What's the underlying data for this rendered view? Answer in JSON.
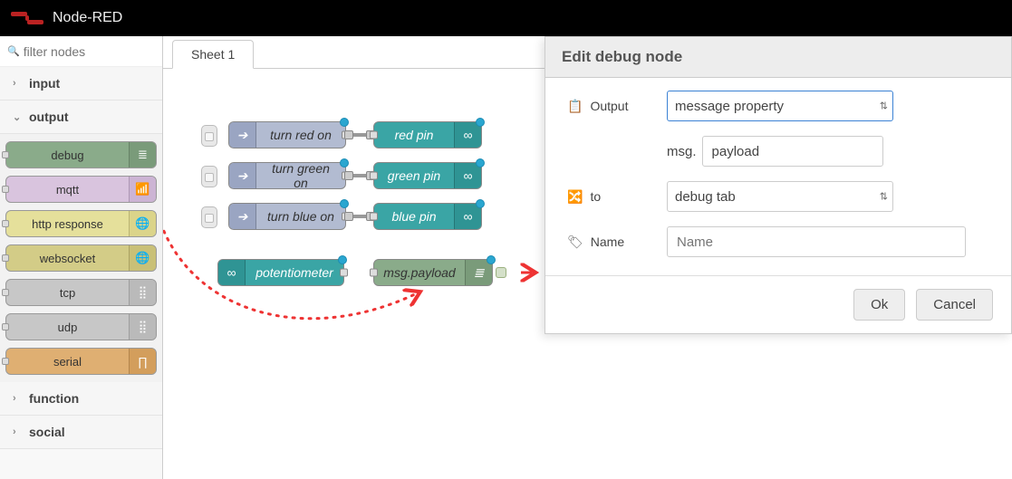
{
  "app": {
    "title": "Node-RED"
  },
  "palette": {
    "filter_placeholder": "filter nodes",
    "categories": {
      "input": {
        "label": "input",
        "open": false
      },
      "output": {
        "label": "output",
        "open": true
      },
      "function": {
        "label": "function",
        "open": false
      },
      "social": {
        "label": "social",
        "open": false
      }
    },
    "output_nodes": {
      "debug": {
        "label": "debug",
        "icon": "list"
      },
      "mqtt": {
        "label": "mqtt",
        "icon": "signal"
      },
      "http": {
        "label": "http response",
        "icon": "globe"
      },
      "ws": {
        "label": "websocket",
        "icon": "globe"
      },
      "tcp": {
        "label": "tcp",
        "icon": "bars"
      },
      "udp": {
        "label": "udp",
        "icon": "bars"
      },
      "serial": {
        "label": "serial",
        "icon": "pulse"
      }
    }
  },
  "workspace": {
    "tabs": {
      "0": {
        "label": "Sheet 1"
      }
    },
    "nodes": {
      "inj_red": {
        "label": "turn red on"
      },
      "inj_green": {
        "label": "turn green on"
      },
      "inj_blue": {
        "label": "turn blue on"
      },
      "gp_red": {
        "label": "red pin"
      },
      "gp_green": {
        "label": "green pin"
      },
      "gp_blue": {
        "label": "blue pin"
      },
      "pot": {
        "label": "potentiometer"
      },
      "dbg": {
        "label": "msg.payload"
      }
    }
  },
  "panel": {
    "title": "Edit debug node",
    "rows": {
      "output": {
        "label": "Output",
        "value": "message property"
      },
      "msg": {
        "prefix": "msg.",
        "value": "payload"
      },
      "to": {
        "label": "to",
        "value": "debug tab"
      },
      "name": {
        "label": "Name",
        "placeholder": "Name",
        "value": ""
      }
    },
    "buttons": {
      "ok": "Ok",
      "cancel": "Cancel"
    }
  }
}
